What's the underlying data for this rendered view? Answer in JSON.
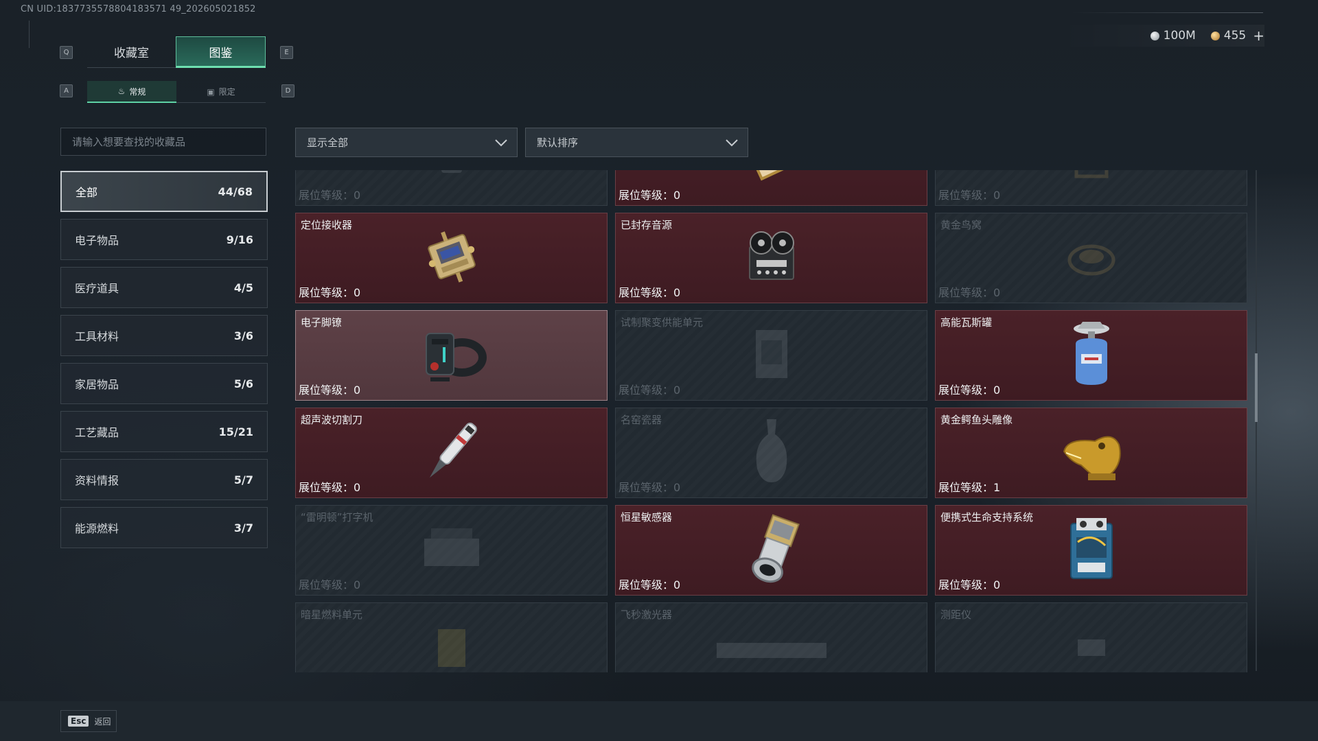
{
  "header": {
    "uid": "CN UID:1837735578804183571 49_202605021852",
    "currency": [
      {
        "icon": "silver-coin-icon",
        "value": "100M"
      },
      {
        "icon": "gold-coin-icon",
        "value": "455"
      }
    ],
    "plus": "+"
  },
  "tabs": {
    "left_key": "Q",
    "right_key": "E",
    "items": [
      {
        "label": "收藏室",
        "active": false
      },
      {
        "label": "图鉴",
        "active": true
      }
    ]
  },
  "subtabs": {
    "left_key": "A",
    "right_key": "D",
    "items": [
      {
        "label": "常规",
        "icon": "flame-icon",
        "active": true
      },
      {
        "label": "限定",
        "icon": "image-icon",
        "active": false
      }
    ]
  },
  "search": {
    "placeholder": "请输入想要查找的收藏品"
  },
  "categories": [
    {
      "label": "全部",
      "count": "44/68",
      "active": true
    },
    {
      "label": "电子物品",
      "count": "9/16",
      "active": false
    },
    {
      "label": "医疗道具",
      "count": "4/5",
      "active": false
    },
    {
      "label": "工具材料",
      "count": "3/6",
      "active": false
    },
    {
      "label": "家居物品",
      "count": "5/6",
      "active": false
    },
    {
      "label": "工艺藏品",
      "count": "15/21",
      "active": false
    },
    {
      "label": "资料情报",
      "count": "5/7",
      "active": false
    },
    {
      "label": "能源燃料",
      "count": "3/7",
      "active": false
    }
  ],
  "filters": {
    "display": "显示全部",
    "sort": "默认排序"
  },
  "items": [
    {
      "name": "",
      "level": "展位等级：0",
      "owned": false,
      "highlight": false,
      "icon": "device-icon"
    },
    {
      "name": "",
      "level": "展位等级：0",
      "owned": true,
      "highlight": false,
      "icon": "painting-icon"
    },
    {
      "name": "",
      "level": "展位等级：0",
      "owned": false,
      "highlight": false,
      "icon": "frame-icon"
    },
    {
      "name": "定位接收器",
      "level": "展位等级：0",
      "owned": true,
      "highlight": false,
      "icon": "gps-receiver-icon"
    },
    {
      "name": "已封存音源",
      "level": "展位等级：0",
      "owned": true,
      "highlight": false,
      "icon": "reel-recorder-icon"
    },
    {
      "name": "黄金鸟窝",
      "level": "展位等级：0",
      "owned": false,
      "highlight": false,
      "icon": "golden-nest-icon"
    },
    {
      "name": "电子脚镣",
      "level": "展位等级：0",
      "owned": true,
      "highlight": true,
      "icon": "ankle-monitor-icon"
    },
    {
      "name": "试制聚变供能单元",
      "level": "展位等级：0",
      "owned": false,
      "highlight": false,
      "icon": "fusion-cell-icon"
    },
    {
      "name": "高能瓦斯罐",
      "level": "展位等级：0",
      "owned": true,
      "highlight": false,
      "icon": "gas-canister-icon"
    },
    {
      "name": "超声波切割刀",
      "level": "展位等级：0",
      "owned": true,
      "highlight": false,
      "icon": "ultrasonic-knife-icon"
    },
    {
      "name": "名窑瓷器",
      "level": "展位等级：0",
      "owned": false,
      "highlight": false,
      "icon": "vase-icon"
    },
    {
      "name": "黄金鳄鱼头雕像",
      "level": "展位等级：1",
      "owned": true,
      "highlight": false,
      "icon": "gold-crocodile-icon"
    },
    {
      "name": "“雷明顿”打字机",
      "level": "展位等级：0",
      "owned": false,
      "highlight": false,
      "icon": "typewriter-icon"
    },
    {
      "name": "恒星敏感器",
      "level": "展位等级：0",
      "owned": true,
      "highlight": false,
      "icon": "star-sensor-icon"
    },
    {
      "name": "便携式生命支持系统",
      "level": "展位等级：0",
      "owned": true,
      "highlight": false,
      "icon": "life-support-icon"
    },
    {
      "name": "暗星燃料单元",
      "level": "",
      "owned": false,
      "highlight": false,
      "icon": "fuel-cell-icon"
    },
    {
      "name": "飞秒激光器",
      "level": "",
      "owned": false,
      "highlight": false,
      "icon": "laser-icon"
    },
    {
      "name": "测距仪",
      "level": "",
      "owned": false,
      "highlight": false,
      "icon": "rangefinder-icon"
    }
  ],
  "footer": {
    "esc_key": "Esc",
    "esc_label": "返回"
  }
}
